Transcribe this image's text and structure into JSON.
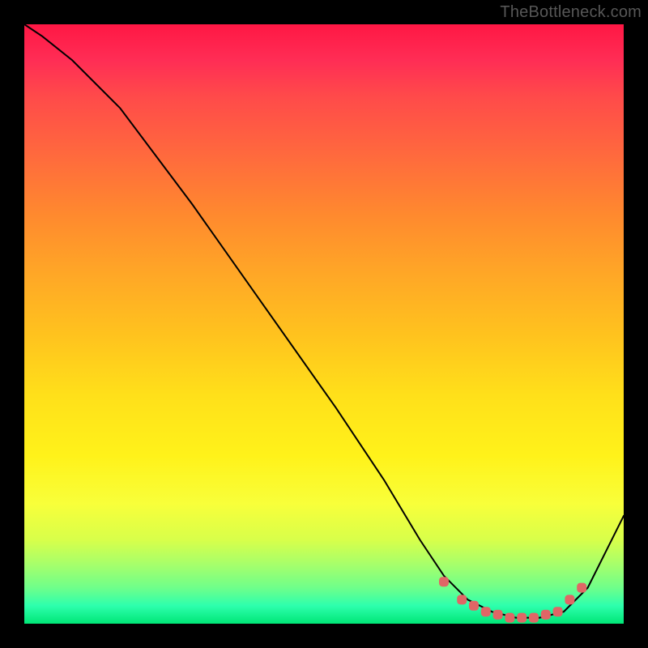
{
  "watermark": "TheBottleneck.com",
  "gradient_colors": {
    "top": "#ff1744",
    "mid": "#ffe01a",
    "bottom": "#00e676"
  },
  "chart_data": {
    "type": "line",
    "title": "",
    "xlabel": "",
    "ylabel": "",
    "xlim": [
      0,
      100
    ],
    "ylim": [
      0,
      100
    ],
    "series": [
      {
        "name": "bottleneck-curve",
        "x": [
          0,
          3,
          8,
          16,
          28,
          40,
          52,
          60,
          66,
          70,
          74,
          78,
          82,
          86,
          90,
          94,
          100
        ],
        "values": [
          100,
          98,
          94,
          86,
          70,
          53,
          36,
          24,
          14,
          8,
          4,
          2,
          1,
          1,
          2,
          6,
          18
        ],
        "stroke": "#000000",
        "stroke_width": 2
      },
      {
        "name": "highlight-dots",
        "x": [
          70,
          73,
          75,
          77,
          79,
          81,
          83,
          85,
          87,
          89,
          91,
          93
        ],
        "values": [
          7,
          4,
          3,
          2,
          1.5,
          1,
          1,
          1,
          1.5,
          2,
          4,
          6
        ],
        "color": "#e06666",
        "marker": "rounded-square",
        "marker_size": 12
      }
    ]
  }
}
